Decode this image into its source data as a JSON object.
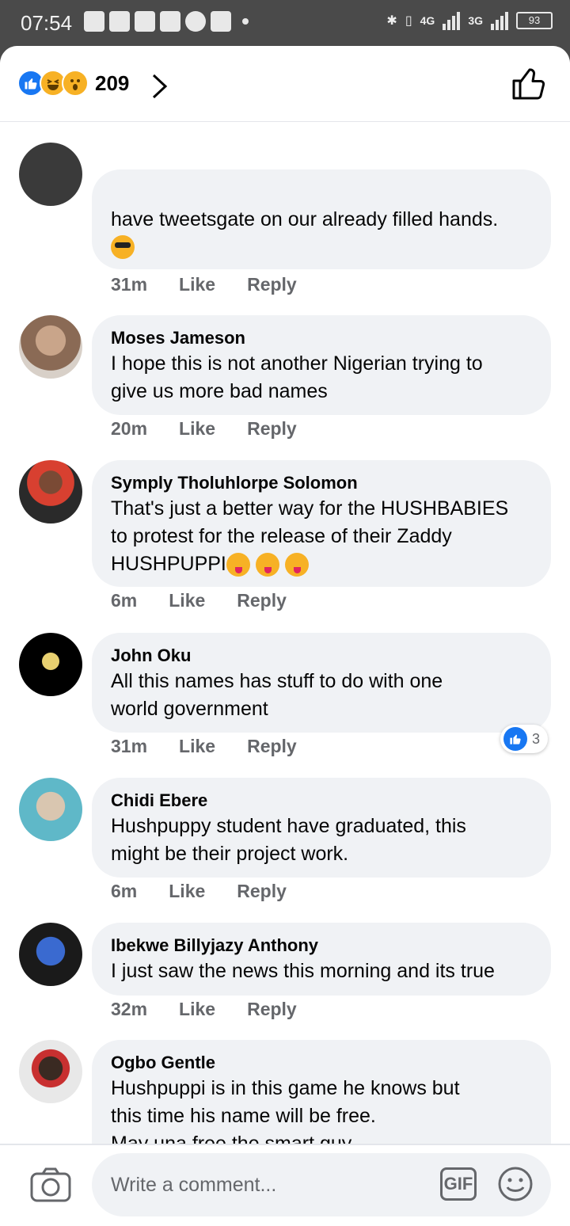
{
  "status_bar": {
    "time": "07:54",
    "net_4g": "4G",
    "net_3g": "3G",
    "battery": "93"
  },
  "header": {
    "reaction_count": "209",
    "reactions": [
      "like-icon",
      "haha-icon",
      "wow-icon"
    ]
  },
  "comments": [
    {
      "name": "",
      "text": "have tweetsgate on our already filled hands.",
      "emoji": "cool",
      "time": "31m",
      "like": "Like",
      "reply": "Reply"
    },
    {
      "name": "Moses Jameson",
      "text": "I hope this is not another Nigerian trying to\ngive us more bad names",
      "time": "20m",
      "like": "Like",
      "reply": "Reply"
    },
    {
      "name": "Symply Tholuhlorpe Solomon",
      "text": "That's just a better way for the HUSHBABIES\nto protest for the release of their Zaddy\nHUSHPUPPI",
      "emoji_count": 3,
      "time": "6m",
      "like": "Like",
      "reply": "Reply"
    },
    {
      "name": "John Oku",
      "text": "All this names has stuff to do with one\nworld government",
      "time": "31m",
      "like": "Like",
      "reply": "Reply",
      "like_badge": "3"
    },
    {
      "name": "Chidi Ebere",
      "text": "Hushpuppy student have graduated, this\nmight be their project work.",
      "time": "6m",
      "like": "Like",
      "reply": "Reply"
    },
    {
      "name": "Ibekwe Billyjazy Anthony",
      "text": "I just saw the news this morning and its true",
      "time": "32m",
      "like": "Like",
      "reply": "Reply"
    },
    {
      "name": "Ogbo Gentle",
      "text": "Hushpuppi is in this game he knows but\nthis time his name will be free.\nMay una free the smart guy\nEnjoyment continue\nNdi ara"
    }
  ],
  "composer": {
    "placeholder": "Write a comment...",
    "gif_label": "GIF"
  },
  "colors": {
    "accent": "#1877f2",
    "bubble": "#f0f2f5",
    "meta_text": "#65676b"
  }
}
